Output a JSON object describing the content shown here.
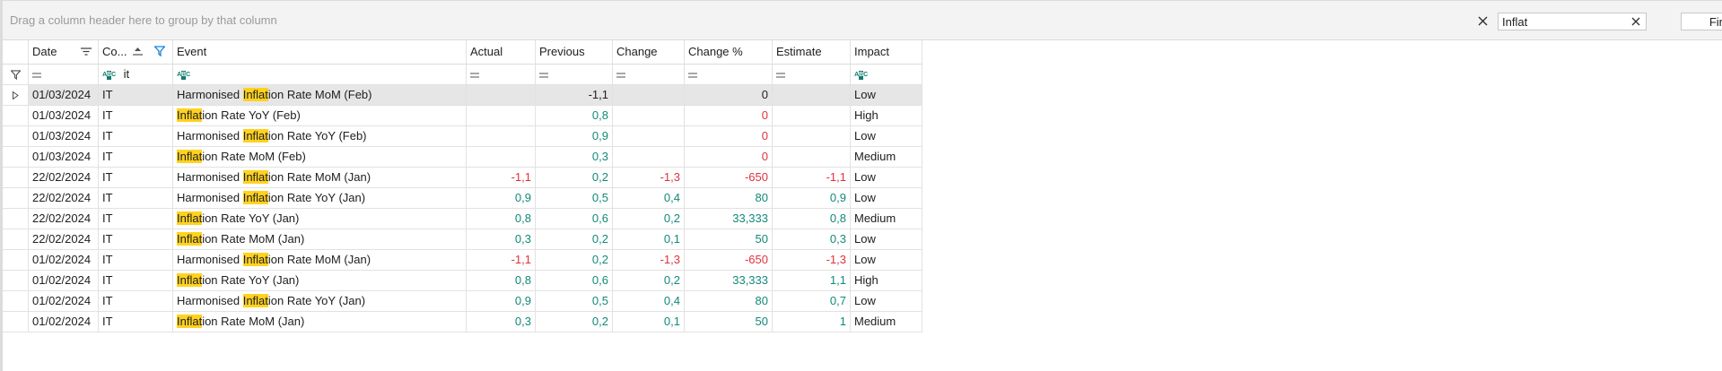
{
  "group_panel": {
    "hint": "Drag a column header here to group by that column"
  },
  "find": {
    "value": "Inflat",
    "button": "Find"
  },
  "columns": {
    "date": "Date",
    "country": "Co...",
    "event": "Event",
    "actual": "Actual",
    "previous": "Previous",
    "change": "Change",
    "change_pct": "Change %",
    "estimate": "Estimate",
    "impact": "Impact"
  },
  "filter_row": {
    "equals": "=",
    "country_value": "it"
  },
  "colors": {
    "positive": "#12897a",
    "negative": "#e0323c",
    "highlight": "#ffd21f",
    "selected_row": "#e6e6e6"
  },
  "highlight_term": "Inflat",
  "rows": [
    {
      "date": "01/03/2024",
      "country": "IT",
      "event_pre": "Harmonised ",
      "event_hl": "Inflat",
      "event_post": "ion Rate MoM (Feb)",
      "actual": "",
      "previous": "-1,1",
      "change": "",
      "change_pct": "0",
      "estimate": "",
      "impact": "Low"
    },
    {
      "date": "01/03/2024",
      "country": "IT",
      "event_pre": "",
      "event_hl": "Inflat",
      "event_post": "ion Rate YoY (Feb)",
      "actual": "",
      "previous": "0,8",
      "change": "",
      "change_pct": "0",
      "estimate": "",
      "impact": "High"
    },
    {
      "date": "01/03/2024",
      "country": "IT",
      "event_pre": "Harmonised ",
      "event_hl": "Inflat",
      "event_post": "ion Rate YoY (Feb)",
      "actual": "",
      "previous": "0,9",
      "change": "",
      "change_pct": "0",
      "estimate": "",
      "impact": "Low"
    },
    {
      "date": "01/03/2024",
      "country": "IT",
      "event_pre": "",
      "event_hl": "Inflat",
      "event_post": "ion Rate MoM (Feb)",
      "actual": "",
      "previous": "0,3",
      "change": "",
      "change_pct": "0",
      "estimate": "",
      "impact": "Medium"
    },
    {
      "date": "22/02/2024",
      "country": "IT",
      "event_pre": "Harmonised ",
      "event_hl": "Inflat",
      "event_post": "ion Rate MoM (Jan)",
      "actual": "-1,1",
      "previous": "0,2",
      "change": "-1,3",
      "change_pct": "-650",
      "estimate": "-1,1",
      "impact": "Low"
    },
    {
      "date": "22/02/2024",
      "country": "IT",
      "event_pre": "Harmonised ",
      "event_hl": "Inflat",
      "event_post": "ion Rate YoY (Jan)",
      "actual": "0,9",
      "previous": "0,5",
      "change": "0,4",
      "change_pct": "80",
      "estimate": "0,9",
      "impact": "Low"
    },
    {
      "date": "22/02/2024",
      "country": "IT",
      "event_pre": "",
      "event_hl": "Inflat",
      "event_post": "ion Rate YoY (Jan)",
      "actual": "0,8",
      "previous": "0,6",
      "change": "0,2",
      "change_pct": "33,333",
      "estimate": "0,8",
      "impact": "Medium"
    },
    {
      "date": "22/02/2024",
      "country": "IT",
      "event_pre": "",
      "event_hl": "Inflat",
      "event_post": "ion Rate MoM (Jan)",
      "actual": "0,3",
      "previous": "0,2",
      "change": "0,1",
      "change_pct": "50",
      "estimate": "0,3",
      "impact": "Low"
    },
    {
      "date": "01/02/2024",
      "country": "IT",
      "event_pre": "Harmonised ",
      "event_hl": "Inflat",
      "event_post": "ion Rate MoM (Jan)",
      "actual": "-1,1",
      "previous": "0,2",
      "change": "-1,3",
      "change_pct": "-650",
      "estimate": "-1,3",
      "impact": "Low"
    },
    {
      "date": "01/02/2024",
      "country": "IT",
      "event_pre": "",
      "event_hl": "Inflat",
      "event_post": "ion Rate YoY (Jan)",
      "actual": "0,8",
      "previous": "0,6",
      "change": "0,2",
      "change_pct": "33,333",
      "estimate": "1,1",
      "impact": "High"
    },
    {
      "date": "01/02/2024",
      "country": "IT",
      "event_pre": "Harmonised ",
      "event_hl": "Inflat",
      "event_post": "ion Rate YoY (Jan)",
      "actual": "0,9",
      "previous": "0,5",
      "change": "0,4",
      "change_pct": "80",
      "estimate": "0,7",
      "impact": "Low"
    },
    {
      "date": "01/02/2024",
      "country": "IT",
      "event_pre": "",
      "event_hl": "Inflat",
      "event_post": "ion Rate MoM (Jan)",
      "actual": "0,3",
      "previous": "0,2",
      "change": "0,1",
      "change_pct": "50",
      "estimate": "1",
      "impact": "Medium"
    }
  ]
}
